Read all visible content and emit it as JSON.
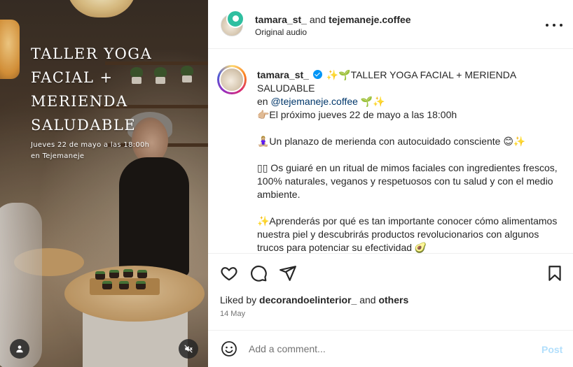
{
  "media": {
    "overlay_title": "TALLER YOGA FACIAL + MERIENDA SALUDABLE",
    "overlay_subtitle_line1": "Jueves 22 de mayo a las 18:00h",
    "overlay_subtitle_line2": "en Tejemaneje",
    "user_tag_icon": "person-icon",
    "mute_icon": "speaker-muted-icon"
  },
  "header": {
    "author": "tamara_st_",
    "and_text": "and",
    "collaborator": "tejemaneje.coffee",
    "audio_label": "Original audio",
    "more_icon": "more-horizontal-icon"
  },
  "caption": {
    "username": "tamara_st_",
    "line1": "✨🌱TALLER YOGA FACIAL + MERIENDA SALUDABLE",
    "line1_en": "en",
    "mention": "@tejemaneje.coffee",
    "line1_tail": "🌱✨",
    "p1": "👉🏼El próximo jueves 22 de mayo a las 18:00h",
    "p2": "🧘🏼‍♀️Un planazo de merienda con autocuidado consciente 😊✨",
    "p3": "▯▯ Os guiaré en un ritual de mimos faciales con ingredientes frescos, 100% naturales, veganos y respetuosos con tu salud y con el medio ambiente.",
    "p4": "✨Aprenderás por qué es tan importante conocer cómo alimentamos nuestra piel y descubrirás productos revolucionarios con algunos trucos para potenciar su efectividad 🥑"
  },
  "actions": {
    "like_icon": "heart-icon",
    "comment_icon": "comment-icon",
    "share_icon": "send-icon",
    "save_icon": "bookmark-icon"
  },
  "likes": {
    "prefix": "Liked by",
    "user": "decorandoelinterior_",
    "and": "and",
    "others": "others"
  },
  "date": "14 May",
  "comment": {
    "placeholder": "Add a comment...",
    "post_label": "Post",
    "emoji_icon": "emoji-smile-icon"
  },
  "colors": {
    "text": "#262626",
    "secondary": "#737373",
    "link": "#00376b",
    "verified": "#0095f6",
    "post_disabled": "#b2dffc"
  }
}
